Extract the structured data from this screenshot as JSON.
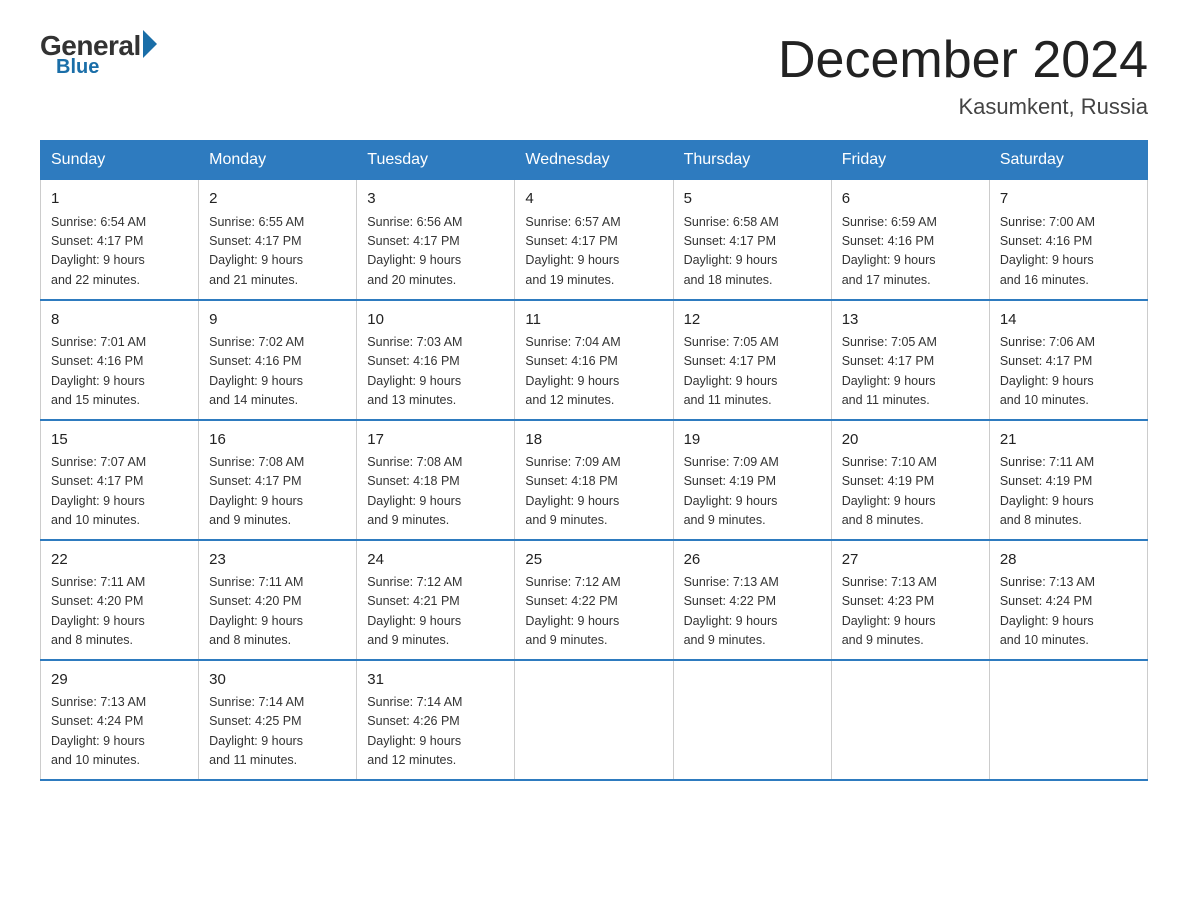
{
  "logo": {
    "general": "General",
    "blue": "Blue"
  },
  "title": "December 2024",
  "subtitle": "Kasumkent, Russia",
  "weekdays": [
    "Sunday",
    "Monday",
    "Tuesday",
    "Wednesday",
    "Thursday",
    "Friday",
    "Saturday"
  ],
  "weeks": [
    [
      {
        "day": "1",
        "sunrise": "6:54 AM",
        "sunset": "4:17 PM",
        "daylight": "9 hours and 22 minutes."
      },
      {
        "day": "2",
        "sunrise": "6:55 AM",
        "sunset": "4:17 PM",
        "daylight": "9 hours and 21 minutes."
      },
      {
        "day": "3",
        "sunrise": "6:56 AM",
        "sunset": "4:17 PM",
        "daylight": "9 hours and 20 minutes."
      },
      {
        "day": "4",
        "sunrise": "6:57 AM",
        "sunset": "4:17 PM",
        "daylight": "9 hours and 19 minutes."
      },
      {
        "day": "5",
        "sunrise": "6:58 AM",
        "sunset": "4:17 PM",
        "daylight": "9 hours and 18 minutes."
      },
      {
        "day": "6",
        "sunrise": "6:59 AM",
        "sunset": "4:16 PM",
        "daylight": "9 hours and 17 minutes."
      },
      {
        "day": "7",
        "sunrise": "7:00 AM",
        "sunset": "4:16 PM",
        "daylight": "9 hours and 16 minutes."
      }
    ],
    [
      {
        "day": "8",
        "sunrise": "7:01 AM",
        "sunset": "4:16 PM",
        "daylight": "9 hours and 15 minutes."
      },
      {
        "day": "9",
        "sunrise": "7:02 AM",
        "sunset": "4:16 PM",
        "daylight": "9 hours and 14 minutes."
      },
      {
        "day": "10",
        "sunrise": "7:03 AM",
        "sunset": "4:16 PM",
        "daylight": "9 hours and 13 minutes."
      },
      {
        "day": "11",
        "sunrise": "7:04 AM",
        "sunset": "4:16 PM",
        "daylight": "9 hours and 12 minutes."
      },
      {
        "day": "12",
        "sunrise": "7:05 AM",
        "sunset": "4:17 PM",
        "daylight": "9 hours and 11 minutes."
      },
      {
        "day": "13",
        "sunrise": "7:05 AM",
        "sunset": "4:17 PM",
        "daylight": "9 hours and 11 minutes."
      },
      {
        "day": "14",
        "sunrise": "7:06 AM",
        "sunset": "4:17 PM",
        "daylight": "9 hours and 10 minutes."
      }
    ],
    [
      {
        "day": "15",
        "sunrise": "7:07 AM",
        "sunset": "4:17 PM",
        "daylight": "9 hours and 10 minutes."
      },
      {
        "day": "16",
        "sunrise": "7:08 AM",
        "sunset": "4:17 PM",
        "daylight": "9 hours and 9 minutes."
      },
      {
        "day": "17",
        "sunrise": "7:08 AM",
        "sunset": "4:18 PM",
        "daylight": "9 hours and 9 minutes."
      },
      {
        "day": "18",
        "sunrise": "7:09 AM",
        "sunset": "4:18 PM",
        "daylight": "9 hours and 9 minutes."
      },
      {
        "day": "19",
        "sunrise": "7:09 AM",
        "sunset": "4:19 PM",
        "daylight": "9 hours and 9 minutes."
      },
      {
        "day": "20",
        "sunrise": "7:10 AM",
        "sunset": "4:19 PM",
        "daylight": "9 hours and 8 minutes."
      },
      {
        "day": "21",
        "sunrise": "7:11 AM",
        "sunset": "4:19 PM",
        "daylight": "9 hours and 8 minutes."
      }
    ],
    [
      {
        "day": "22",
        "sunrise": "7:11 AM",
        "sunset": "4:20 PM",
        "daylight": "9 hours and 8 minutes."
      },
      {
        "day": "23",
        "sunrise": "7:11 AM",
        "sunset": "4:20 PM",
        "daylight": "9 hours and 8 minutes."
      },
      {
        "day": "24",
        "sunrise": "7:12 AM",
        "sunset": "4:21 PM",
        "daylight": "9 hours and 9 minutes."
      },
      {
        "day": "25",
        "sunrise": "7:12 AM",
        "sunset": "4:22 PM",
        "daylight": "9 hours and 9 minutes."
      },
      {
        "day": "26",
        "sunrise": "7:13 AM",
        "sunset": "4:22 PM",
        "daylight": "9 hours and 9 minutes."
      },
      {
        "day": "27",
        "sunrise": "7:13 AM",
        "sunset": "4:23 PM",
        "daylight": "9 hours and 9 minutes."
      },
      {
        "day": "28",
        "sunrise": "7:13 AM",
        "sunset": "4:24 PM",
        "daylight": "9 hours and 10 minutes."
      }
    ],
    [
      {
        "day": "29",
        "sunrise": "7:13 AM",
        "sunset": "4:24 PM",
        "daylight": "9 hours and 10 minutes."
      },
      {
        "day": "30",
        "sunrise": "7:14 AM",
        "sunset": "4:25 PM",
        "daylight": "9 hours and 11 minutes."
      },
      {
        "day": "31",
        "sunrise": "7:14 AM",
        "sunset": "4:26 PM",
        "daylight": "9 hours and 12 minutes."
      },
      null,
      null,
      null,
      null
    ]
  ],
  "labels": {
    "sunrise": "Sunrise:",
    "sunset": "Sunset:",
    "daylight": "Daylight:"
  }
}
